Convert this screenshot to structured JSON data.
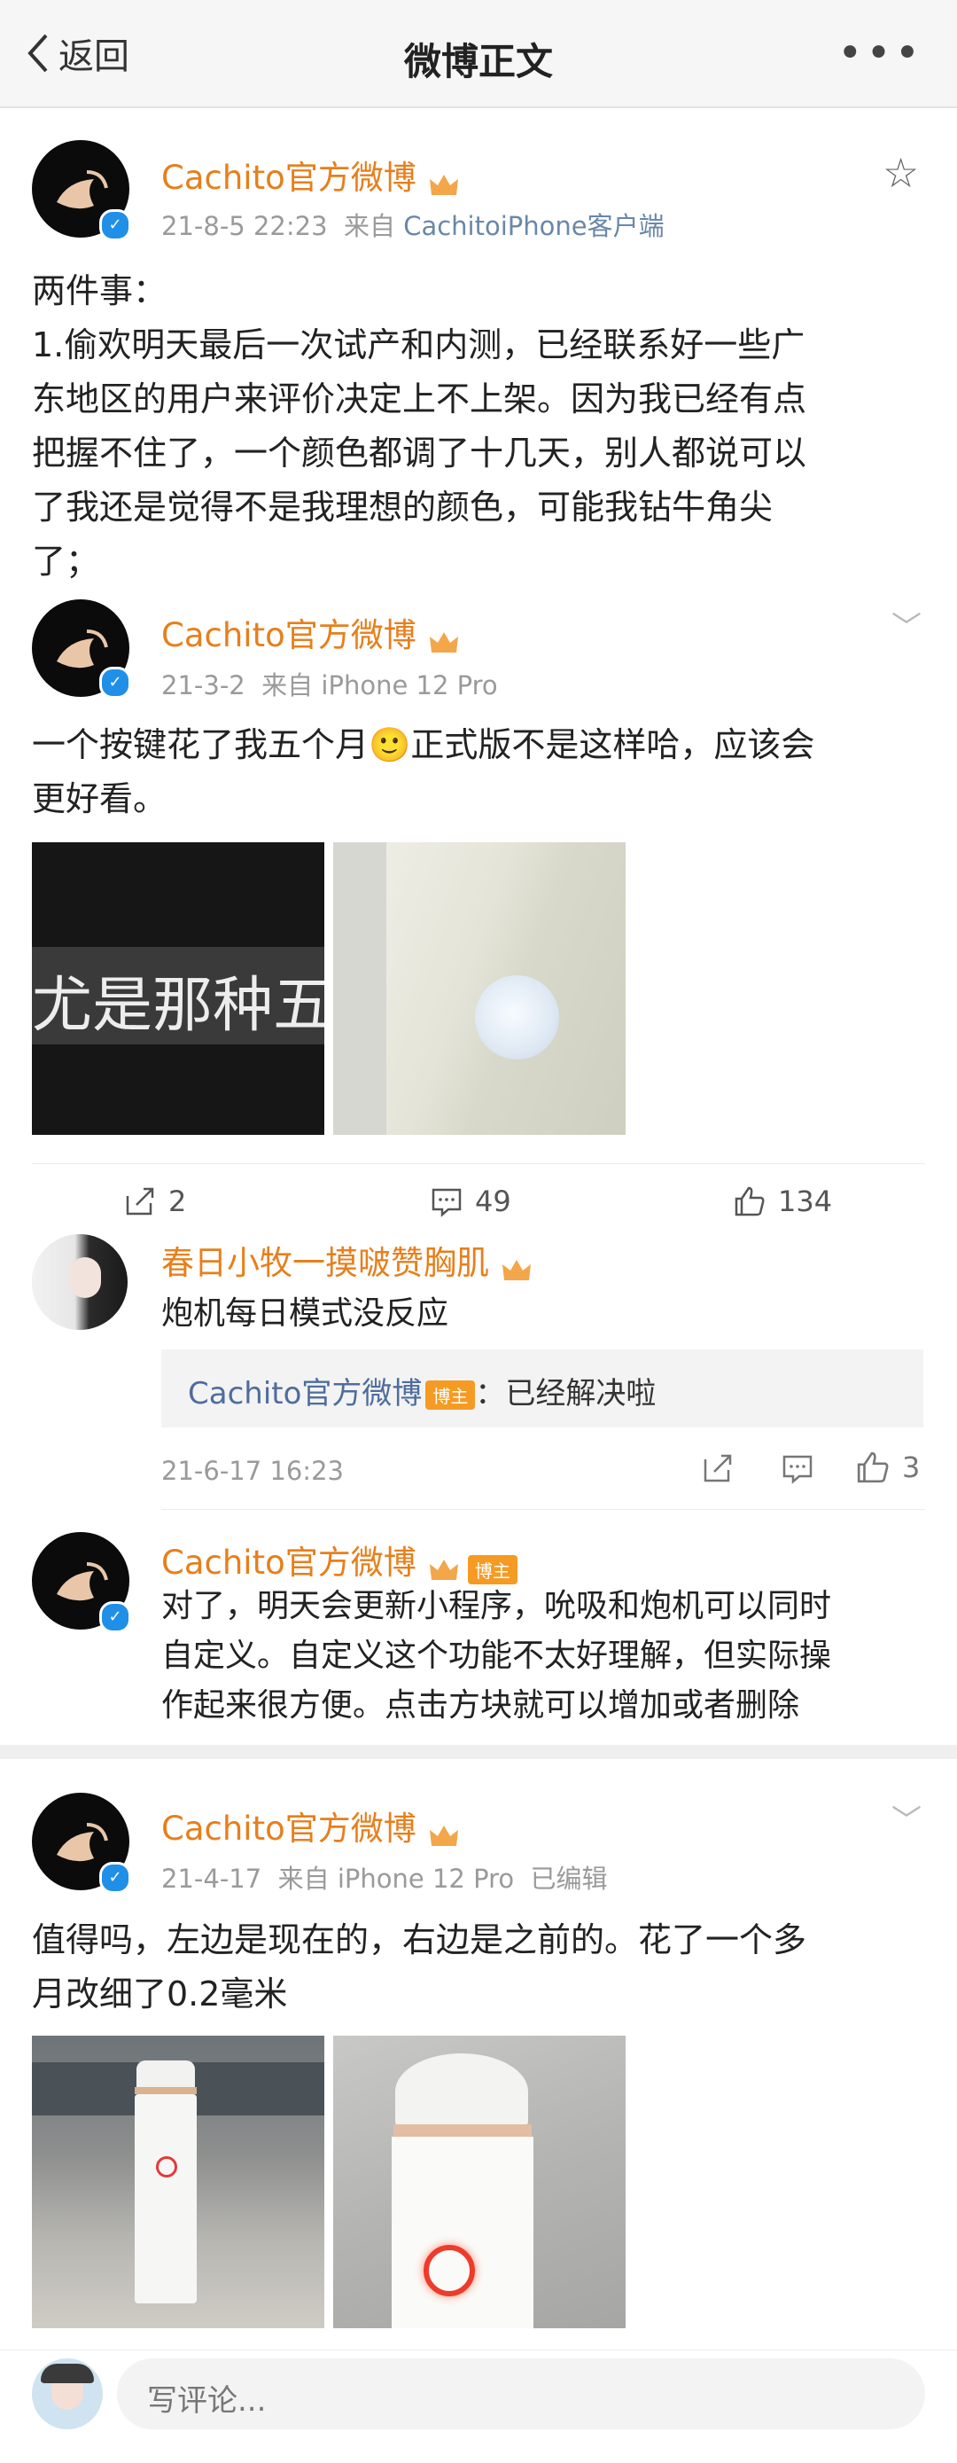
{
  "header": {
    "back_label": "返回",
    "title": "微博正文"
  },
  "post1": {
    "username": "Cachito官方微博",
    "time": "21-8-5 22:23",
    "source_prefix": "来自",
    "source": "CachitoiPhone客户端",
    "lines": [
      "两件事：",
      "1.偷欢明天最后一次试产和内测，已经联系好一些广",
      "东地区的用户来评价决定上不上架。因为我已经有点",
      "把握不住了，一个颜色都调了十几天，别人都说可以",
      "了我还是觉得不是我理想的颜色，可能我钻牛角尖",
      "了；"
    ]
  },
  "post2": {
    "username": "Cachito官方微博",
    "time": "21-3-2",
    "source_prefix": "来自",
    "source": "iPhone 12 Pro",
    "line1_a": "一个按键花了我五个月",
    "line1_emoji": "🙂",
    "line1_b": "正式版不是这样哈，应该会",
    "line2": "更好看。",
    "image1_text": "尤是那种五",
    "reposts": "2",
    "comments": "49",
    "likes": "134"
  },
  "comment1": {
    "username": "春日小牧一摸啵赞胸肌",
    "text": "炮机每日模式没反应",
    "reply_user": "Cachito官方微博",
    "reply_badge": "博主",
    "reply_text": "：已经解决啦",
    "time": "21-6-17 16:23",
    "likes": "3"
  },
  "comment2": {
    "username": "Cachito官方微博",
    "badge": "博主",
    "lines": [
      "对了，明天会更新小程序，吮吸和炮机可以同时",
      "自定义。自定义这个功能不太好理解，但实际操",
      "作起来很方便。点击方块就可以增加或者删除"
    ]
  },
  "post3": {
    "username": "Cachito官方微博",
    "time": "21-4-17",
    "source_prefix": "来自",
    "source": "iPhone 12 Pro",
    "edited": "已编辑",
    "lines": [
      "值得吗，左边是现在的，右边是之前的。花了一个多",
      "月改细了0.2毫米"
    ]
  },
  "comment_bar": {
    "placeholder": "写评论..."
  },
  "colors": {
    "username": "#e77f1c",
    "verified": "#1f8fe8",
    "source_link": "#6a87aa",
    "reply_link": "#4e6d9c"
  }
}
